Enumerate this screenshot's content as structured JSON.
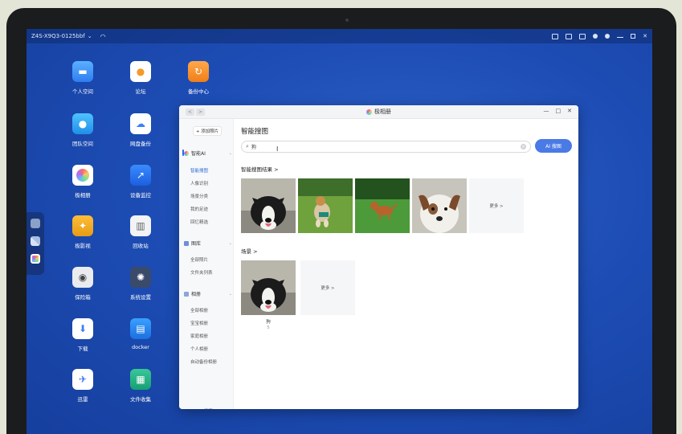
{
  "topbar": {
    "hostname": "Z4S-X9Q3-0125bbf",
    "caret": "⌄"
  },
  "desktop_icons": [
    {
      "label": "个人空间",
      "icon": "folder-icon"
    },
    {
      "label": "论坛",
      "icon": "forum-icon"
    },
    {
      "label": "备份中心",
      "icon": "backup-icon"
    },
    {
      "label": "团队空间",
      "icon": "team-folder-icon"
    },
    {
      "label": "网盘备份",
      "icon": "cloud-backup-icon"
    },
    {
      "label": "极相册",
      "icon": "photo-album-icon"
    },
    {
      "label": "设备监控",
      "icon": "monitor-chart-icon"
    },
    {
      "label": "极影视",
      "icon": "movie-icon"
    },
    {
      "label": "回收站",
      "icon": "trash-icon"
    },
    {
      "label": "保险箱",
      "icon": "safe-icon"
    },
    {
      "label": "系统设置",
      "icon": "settings-icon"
    },
    {
      "label": "下载",
      "icon": "download-icon"
    },
    {
      "label": "docker",
      "icon": "docker-icon"
    },
    {
      "label": "迅雷",
      "icon": "thunder-icon"
    },
    {
      "label": "文件收集",
      "icon": "file-collect-icon"
    }
  ],
  "window": {
    "title": "极相册",
    "nav_back": "<",
    "nav_forward": ">",
    "controls": {
      "minimize": "—",
      "maximize": "□",
      "close": "✕"
    }
  },
  "sidebar": {
    "add_photo": "+ 添加照片",
    "sections": [
      {
        "label": "智能AI",
        "items": [
          "智能搜图",
          "人像识别",
          "场景分类",
          "我的足迹",
          "回忆精选"
        ]
      },
      {
        "label": "图库",
        "items": [
          "全部照片",
          "文件夹列表"
        ]
      },
      {
        "label": "相册",
        "items": [
          "全部相册",
          "宝宝相册",
          "家庭相册",
          "个人相册",
          "自动备份相册"
        ]
      }
    ],
    "settings": "设置"
  },
  "main": {
    "title": "智能搜图",
    "search_value": "狗",
    "ai_search": "AI 搜图",
    "results_title": "智能搜图结果 >",
    "more": "更多 >",
    "scene_title": "场景 >",
    "scene_label": "狗",
    "scene_count": "5"
  },
  "colors": {
    "accent": "#4a7ae6",
    "active_nav": "#2f6bdc",
    "desktop": "#1d4db5"
  }
}
